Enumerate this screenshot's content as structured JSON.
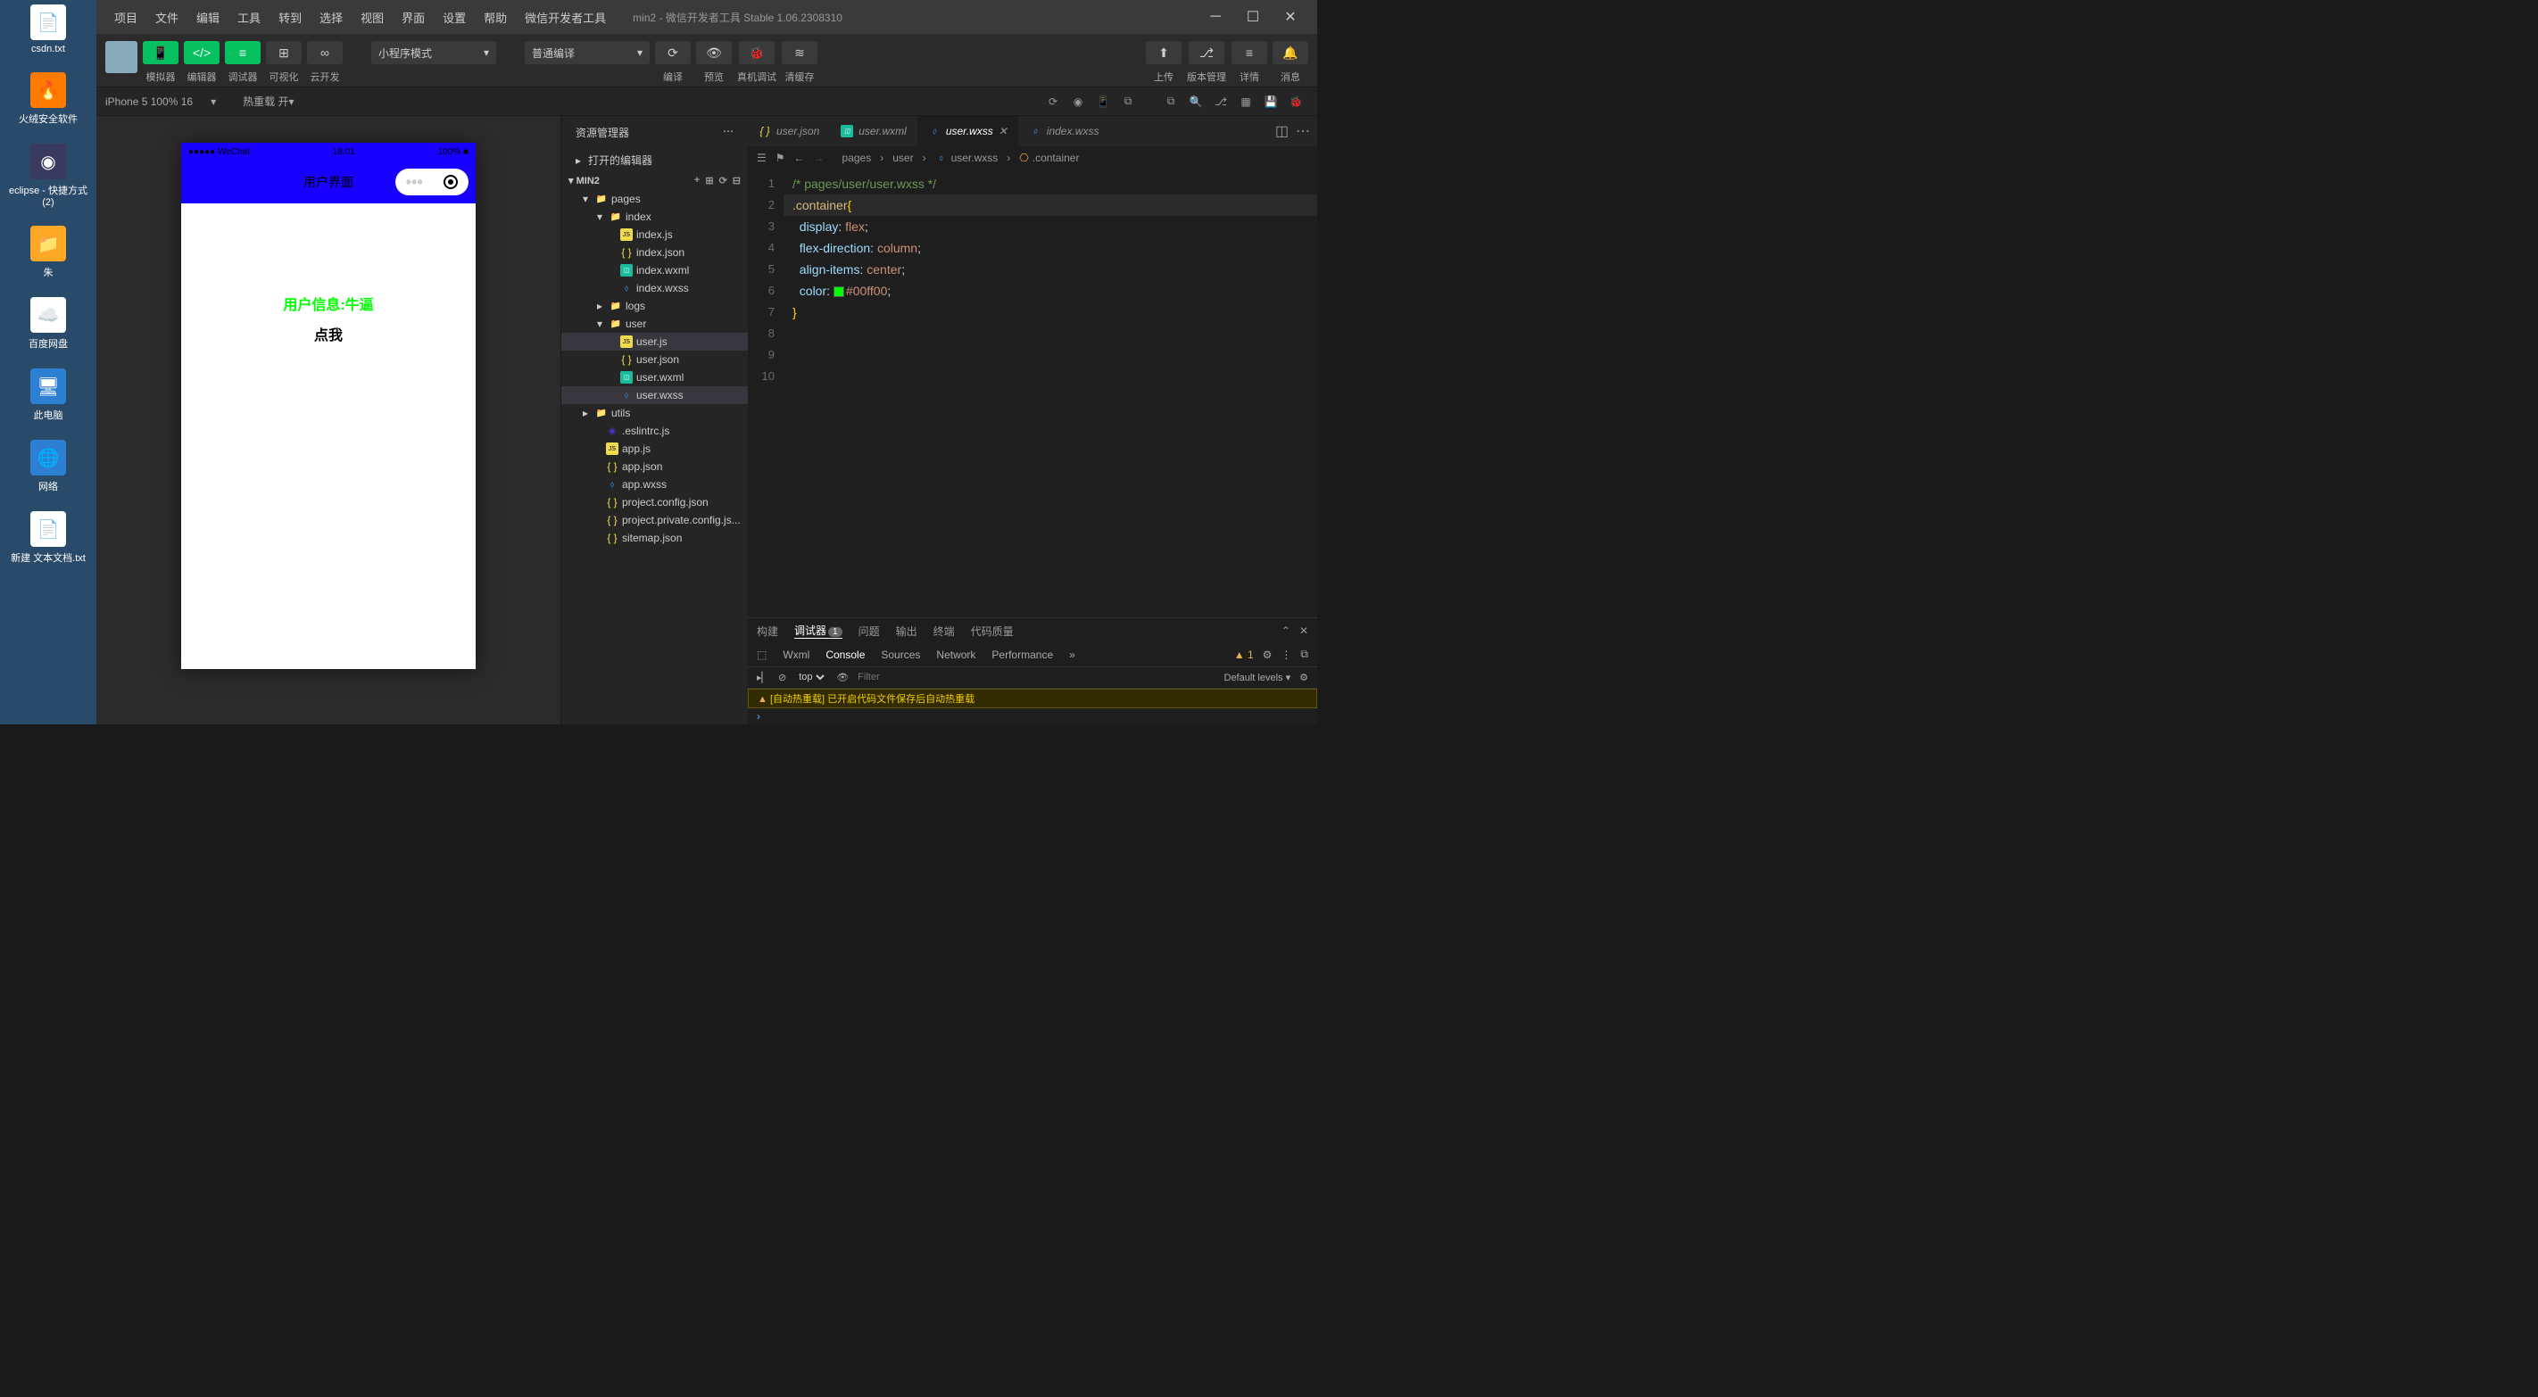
{
  "desktop_icons": [
    {
      "label": "csdn.txt",
      "color": "#fff"
    },
    {
      "label": "火绒安全软件",
      "color": "#ff7a00"
    },
    {
      "label": "eclipse - 快捷方式 (2)",
      "color": "#3a3a60"
    },
    {
      "label": "朱",
      "color": "#ffa726"
    },
    {
      "label": "百度网盘",
      "color": "#fff"
    },
    {
      "label": "此电脑",
      "color": "#2d7fd4"
    },
    {
      "label": "网络",
      "color": "#2d7fd4"
    },
    {
      "label": "新建 文本文档.txt",
      "color": "#fff"
    }
  ],
  "menubar": {
    "items": [
      "项目",
      "文件",
      "编辑",
      "工具",
      "转到",
      "选择",
      "视图",
      "界面",
      "设置",
      "帮助",
      "微信开发者工具"
    ],
    "title": "min2 - 微信开发者工具 Stable 1.06.2308310"
  },
  "toolbar": {
    "simulator": "模拟器",
    "editor": "编辑器",
    "debugger": "调试器",
    "visualize": "可视化",
    "cloud": "云开发",
    "mode": "小程序模式",
    "compile": "普通编译",
    "compile_label": "编译",
    "preview": "预览",
    "remote_debug": "真机调试",
    "clear_cache": "清缓存",
    "upload": "上传",
    "version": "版本管理",
    "details": "详情",
    "messages": "消息"
  },
  "editor_bar": {
    "device": "iPhone 5 100% 16",
    "hot_reload": "热重载 开"
  },
  "phone": {
    "status_left": "●●●●● WeChat",
    "status_time": "18:01",
    "status_right": "100%",
    "nav_title": "用户界面",
    "user_info": "用户信息:牛逼",
    "click_me": "点我"
  },
  "explorer": {
    "title": "资源管理器",
    "open_editors": "打开的编辑器",
    "project": "MIN2"
  },
  "tree": {
    "pages": "pages",
    "index": "index",
    "index_js": "index.js",
    "index_json": "index.json",
    "index_wxml": "index.wxml",
    "index_wxss": "index.wxss",
    "logs": "logs",
    "user": "user",
    "user_js": "user.js",
    "user_json": "user.json",
    "user_wxml": "user.wxml",
    "user_wxss": "user.wxss",
    "utils": "utils",
    "eslintrc": ".eslintrc.js",
    "app_js": "app.js",
    "app_json": "app.json",
    "app_wxss": "app.wxss",
    "project_config": "project.config.json",
    "project_private": "project.private.config.js...",
    "sitemap": "sitemap.json"
  },
  "tabs": [
    {
      "icon": "js",
      "label": "user.json",
      "active": false
    },
    {
      "icon": "wxml",
      "label": "user.wxml",
      "active": false
    },
    {
      "icon": "wxss",
      "label": "user.wxss",
      "active": true
    },
    {
      "icon": "wxss",
      "label": "index.wxss",
      "active": false
    }
  ],
  "breadcrumb": {
    "pages": "pages",
    "user": "user",
    "file": "user.wxss",
    "selector": ".container"
  },
  "code": {
    "line1": "/* pages/user/user.wxss */",
    "line2_sel": ".container",
    "line3_prop": "display",
    "line3_val": "flex",
    "line4_prop": "flex-direction",
    "line4_val": "column",
    "line5_prop": "align-items",
    "line5_val": "center",
    "line6_prop": "color",
    "line6_val": "#00ff00"
  },
  "panel": {
    "build": "构建",
    "debugger": "调试器",
    "debugger_badge": "1",
    "problems": "问题",
    "output": "输出",
    "terminal": "终端",
    "quality": "代码质量"
  },
  "devtools": {
    "wxml": "Wxml",
    "console": "Console",
    "sources": "Sources",
    "network": "Network",
    "performance": "Performance",
    "warn_count": "1"
  },
  "console": {
    "context": "top",
    "filter_placeholder": "Filter",
    "levels": "Default levels",
    "message": "[自动热重载] 已开启代码文件保存后自动热重载"
  }
}
